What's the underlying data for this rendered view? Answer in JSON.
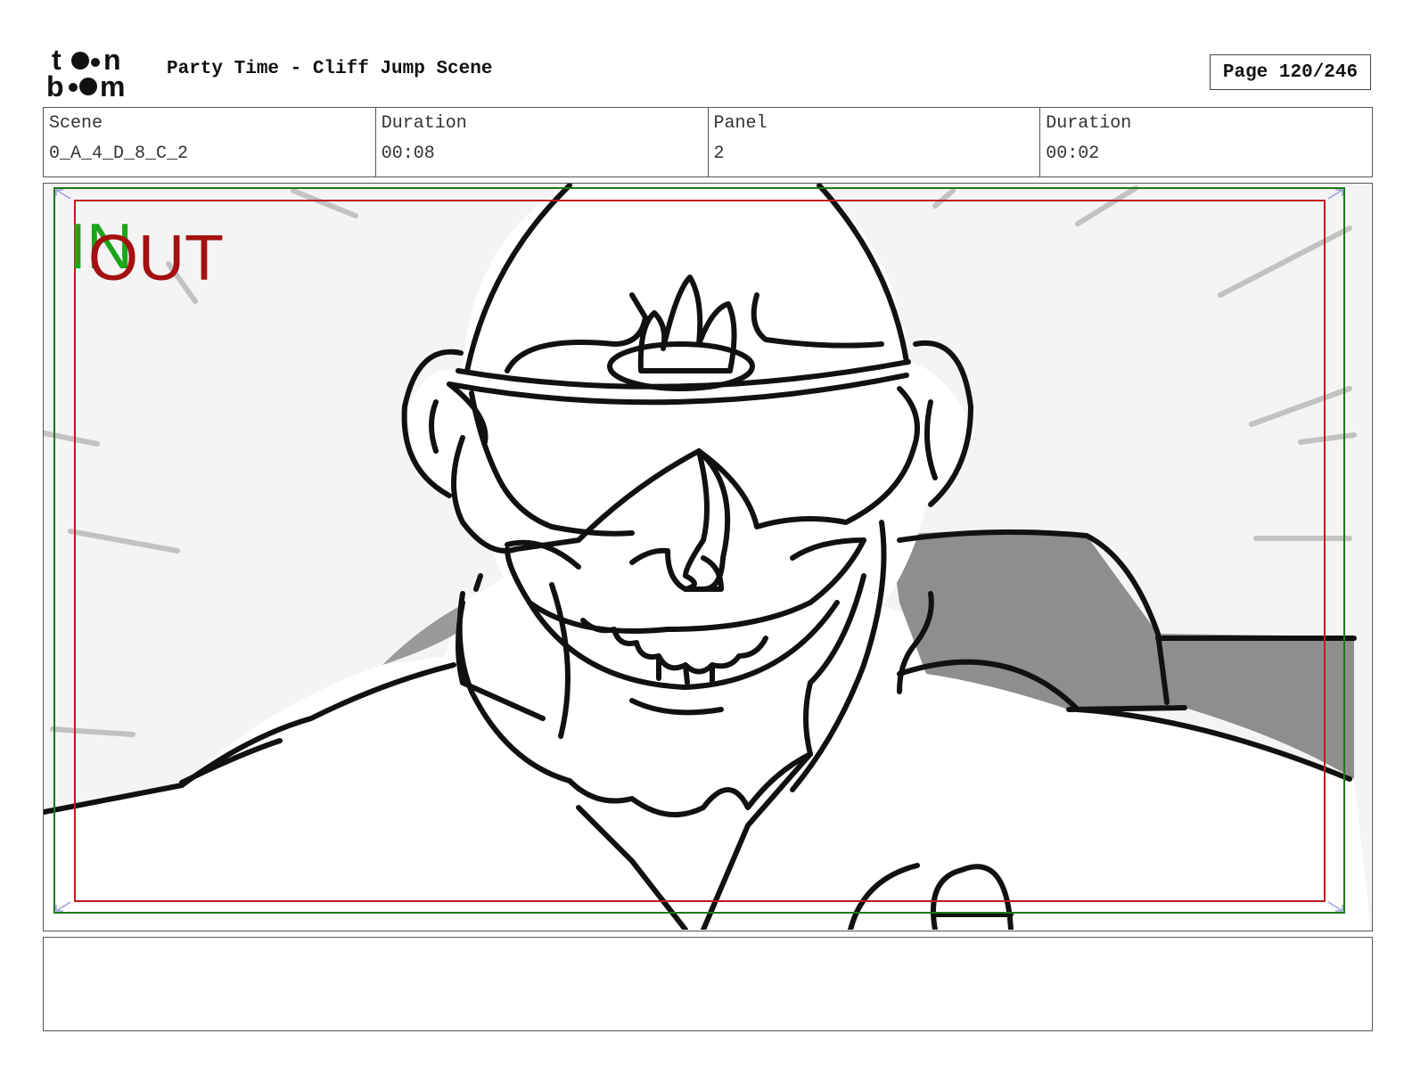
{
  "header": {
    "logo_text": "toon boom",
    "title": "Party Time - Cliff Jump Scene",
    "page_label": "Page 120/246"
  },
  "info": {
    "scene_label": "Scene",
    "scene_value": "0_A_4_D_8_C_2",
    "scene_duration_label": "Duration",
    "scene_duration_value": "00:08",
    "panel_label": "Panel",
    "panel_value": "2",
    "panel_duration_label": "Duration",
    "panel_duration_value": "00:02"
  },
  "panel": {
    "in_marker": "IN",
    "out_marker": "OUT",
    "safe_frame_color": "#1a7a1a",
    "action_frame_color": "#c21a1a"
  },
  "notes": {
    "text": ""
  }
}
